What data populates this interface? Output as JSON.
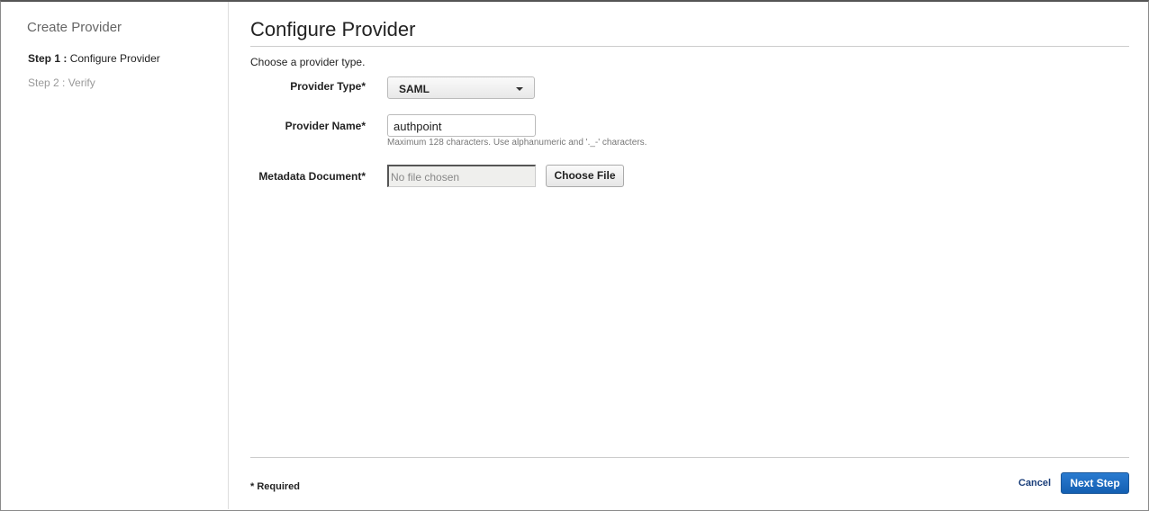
{
  "sidebar": {
    "title": "Create Provider",
    "steps": [
      {
        "prefix": "Step 1 :",
        "label": "Configure Provider"
      },
      {
        "label": "Step 2 : Verify"
      }
    ]
  },
  "main": {
    "title": "Configure Provider",
    "intro": "Choose a provider type.",
    "provider_type": {
      "label": "Provider Type*",
      "value": "SAML"
    },
    "provider_name": {
      "label": "Provider Name*",
      "value": "authpoint",
      "hint": "Maximum 128 characters. Use alphanumeric and '._-' characters."
    },
    "metadata": {
      "label": "Metadata Document*",
      "value": "No file chosen",
      "button": "Choose File"
    }
  },
  "footer": {
    "required": "* Required",
    "cancel": "Cancel",
    "next": "Next Step"
  }
}
